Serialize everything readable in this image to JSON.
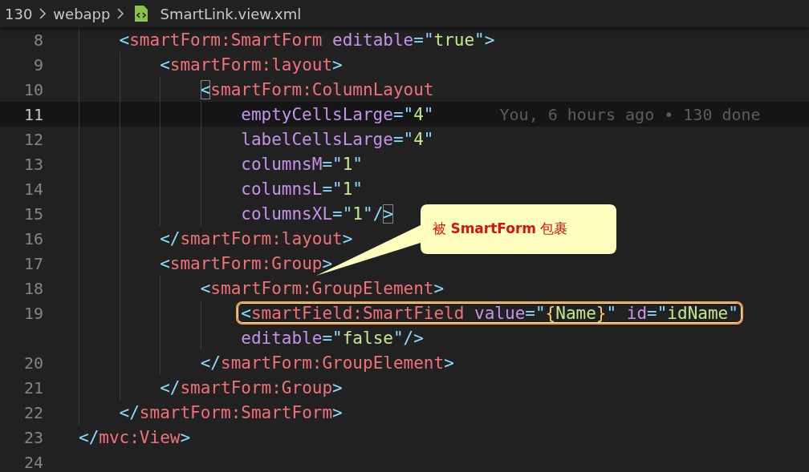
{
  "breadcrumb": {
    "items": [
      "130",
      "webapp"
    ],
    "file": "SmartLink.view.xml"
  },
  "lines": [
    {
      "number": "8",
      "current": false,
      "highlighted": false,
      "tokens": [
        {
          "kind": "punct",
          "text": "    <"
        },
        {
          "kind": "tag",
          "text": "smartForm:SmartForm"
        },
        {
          "kind": "attr",
          "text": " editable"
        },
        {
          "kind": "punct",
          "text": "=\""
        },
        {
          "kind": "string",
          "text": "true"
        },
        {
          "kind": "punct",
          "text": "\">"
        }
      ]
    },
    {
      "number": "9",
      "current": false,
      "highlighted": false,
      "tokens": [
        {
          "kind": "punct",
          "text": "        <"
        },
        {
          "kind": "tag",
          "text": "smartForm:layout"
        },
        {
          "kind": "punct",
          "text": ">"
        }
      ]
    },
    {
      "number": "10",
      "current": false,
      "highlighted": false,
      "tokens": [
        {
          "kind": "punct",
          "text": "            <",
          "match": true
        },
        {
          "kind": "tag",
          "text": "smartForm:ColumnLayout"
        }
      ]
    },
    {
      "number": "11",
      "current": true,
      "highlighted": false,
      "blame": "You, 6 hours ago • 130 done",
      "tokens": [
        {
          "kind": "attr",
          "text": "                emptyCellsLarge"
        },
        {
          "kind": "punct",
          "text": "=\""
        },
        {
          "kind": "string",
          "text": "4"
        },
        {
          "kind": "punct",
          "text": "\""
        }
      ]
    },
    {
      "number": "12",
      "current": false,
      "highlighted": false,
      "tokens": [
        {
          "kind": "attr",
          "text": "                labelCellsLarge"
        },
        {
          "kind": "punct",
          "text": "=\""
        },
        {
          "kind": "string",
          "text": "4"
        },
        {
          "kind": "punct",
          "text": "\""
        }
      ]
    },
    {
      "number": "13",
      "current": false,
      "highlighted": false,
      "tokens": [
        {
          "kind": "attr",
          "text": "                columnsM"
        },
        {
          "kind": "punct",
          "text": "=\""
        },
        {
          "kind": "string",
          "text": "1"
        },
        {
          "kind": "punct",
          "text": "\""
        }
      ]
    },
    {
      "number": "14",
      "current": false,
      "highlighted": false,
      "tokens": [
        {
          "kind": "attr",
          "text": "                columnsL"
        },
        {
          "kind": "punct",
          "text": "=\""
        },
        {
          "kind": "string",
          "text": "1"
        },
        {
          "kind": "punct",
          "text": "\""
        }
      ]
    },
    {
      "number": "15",
      "current": false,
      "highlighted": false,
      "tokens": [
        {
          "kind": "attr",
          "text": "                columnsXL"
        },
        {
          "kind": "punct",
          "text": "=\""
        },
        {
          "kind": "string",
          "text": "1"
        },
        {
          "kind": "punct",
          "text": "\"/"
        },
        {
          "kind": "punct",
          "text": ">",
          "match": true
        }
      ]
    },
    {
      "number": "16",
      "current": false,
      "highlighted": false,
      "tokens": [
        {
          "kind": "punct",
          "text": "        </"
        },
        {
          "kind": "tag",
          "text": "smartForm:layout"
        },
        {
          "kind": "punct",
          "text": ">"
        }
      ]
    },
    {
      "number": "17",
      "current": false,
      "highlighted": false,
      "tokens": [
        {
          "kind": "punct",
          "text": "        <"
        },
        {
          "kind": "tag",
          "text": "smartForm:Group"
        },
        {
          "kind": "punct",
          "text": ">"
        }
      ]
    },
    {
      "number": "18",
      "current": false,
      "highlighted": false,
      "tokens": [
        {
          "kind": "punct",
          "text": "            <"
        },
        {
          "kind": "tag",
          "text": "smartForm:GroupElement"
        },
        {
          "kind": "punct",
          "text": ">"
        }
      ]
    },
    {
      "number": "19",
      "current": false,
      "highlighted": true,
      "tokens": [
        {
          "kind": "punct",
          "text": "                <"
        },
        {
          "kind": "tag",
          "text": "smartField:SmartField"
        },
        {
          "kind": "attr",
          "text": " value"
        },
        {
          "kind": "punct",
          "text": "=\""
        },
        {
          "kind": "brace",
          "text": "{"
        },
        {
          "kind": "string",
          "text": "Name"
        },
        {
          "kind": "brace",
          "text": "}"
        },
        {
          "kind": "punct",
          "text": "\""
        },
        {
          "kind": "attr",
          "text": " id"
        },
        {
          "kind": "punct",
          "text": "=\""
        },
        {
          "kind": "string",
          "text": "idName"
        },
        {
          "kind": "punct",
          "text": "\""
        }
      ]
    },
    {
      "current": false,
      "highlighted": false,
      "tokens": [
        {
          "kind": "attr",
          "text": "                editable"
        },
        {
          "kind": "punct",
          "text": "=\""
        },
        {
          "kind": "string",
          "text": "false"
        },
        {
          "kind": "punct",
          "text": "\"/>"
        }
      ]
    },
    {
      "number": "20",
      "current": false,
      "highlighted": false,
      "tokens": [
        {
          "kind": "punct",
          "text": "            </"
        },
        {
          "kind": "tag",
          "text": "smartForm:GroupElement"
        },
        {
          "kind": "punct",
          "text": ">"
        }
      ]
    },
    {
      "number": "21",
      "current": false,
      "highlighted": false,
      "tokens": [
        {
          "kind": "punct",
          "text": "        </"
        },
        {
          "kind": "tag",
          "text": "smartForm:Group"
        },
        {
          "kind": "punct",
          "text": ">"
        }
      ]
    },
    {
      "number": "22",
      "current": false,
      "highlighted": false,
      "tokens": [
        {
          "kind": "punct",
          "text": "    </"
        },
        {
          "kind": "tag",
          "text": "smartForm:SmartForm"
        },
        {
          "kind": "punct",
          "text": ">"
        }
      ]
    },
    {
      "number": "23",
      "current": false,
      "highlighted": false,
      "tokens": [
        {
          "kind": "punct",
          "text": "</"
        },
        {
          "kind": "tag",
          "text": "mvc:View"
        },
        {
          "kind": "punct",
          "text": ">"
        }
      ]
    },
    {
      "number": "24",
      "current": false
    }
  ],
  "callout": {
    "text": "被 **SmartForm** 包裹"
  }
}
